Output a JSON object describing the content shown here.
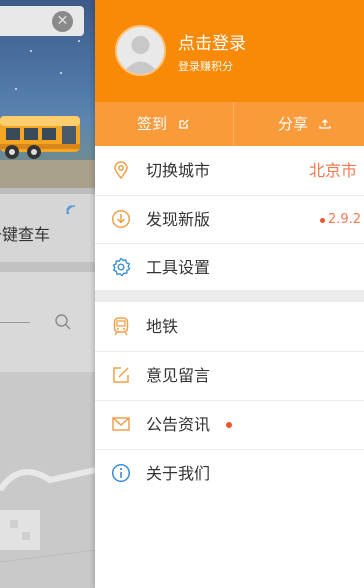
{
  "background_app": {
    "quick_search_label": "一键查车"
  },
  "drawer": {
    "header": {
      "login_title": "点击登录",
      "login_subtitle": "登录赚积分"
    },
    "actions": {
      "sign_in": "签到",
      "share": "分享"
    },
    "menu": [
      {
        "label": "切换城市",
        "icon": "location-pin-icon",
        "value": "北京市"
      },
      {
        "label": "发现新版",
        "icon": "download-circle-icon",
        "value": "2.9.2",
        "badge": true
      },
      {
        "label": "工具设置",
        "icon": "gear-icon"
      },
      {
        "label": "地铁",
        "icon": "subway-icon"
      },
      {
        "label": "意见留言",
        "icon": "edit-icon"
      },
      {
        "label": "公告资讯",
        "icon": "envelope-icon",
        "badge": true
      },
      {
        "label": "关于我们",
        "icon": "info-icon"
      }
    ]
  },
  "colors": {
    "brand_orange": "#f98a07",
    "action_bar": "#f99b3a",
    "icon_orange": "#f0a04a",
    "icon_blue": "#3a8fd8",
    "highlight_red": "#f07a52"
  }
}
